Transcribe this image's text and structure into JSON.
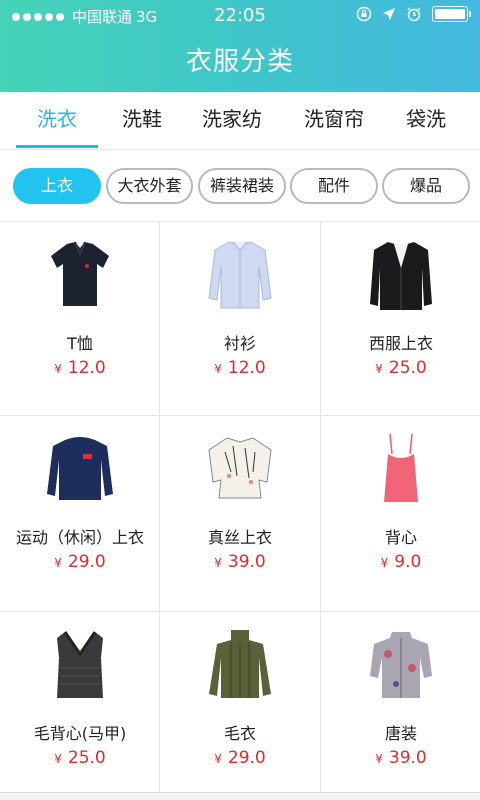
{
  "status_bar": {
    "carrier": "中国联通",
    "network": "3G",
    "time": "22:05"
  },
  "header": {
    "title": "衣服分类"
  },
  "tabs": [
    {
      "label": "洗衣",
      "active": true
    },
    {
      "label": "洗鞋",
      "active": false
    },
    {
      "label": "洗家纺",
      "active": false
    },
    {
      "label": "洗窗帘",
      "active": false
    },
    {
      "label": "袋洗",
      "active": false
    }
  ],
  "subcategories": [
    {
      "label": "上衣",
      "active": true
    },
    {
      "label": "大衣外套",
      "active": false
    },
    {
      "label": "裤装裙装",
      "active": false
    },
    {
      "label": "配件",
      "active": false
    },
    {
      "label": "爆品",
      "active": false
    }
  ],
  "currency": "¥",
  "products": [
    {
      "name": "T恤",
      "price": "12.0",
      "icon": "polo-shirt-image"
    },
    {
      "name": "衬衫",
      "price": "12.0",
      "icon": "dress-shirt-image"
    },
    {
      "name": "西服上衣",
      "price": "25.0",
      "icon": "suit-jacket-image"
    },
    {
      "name": "运动（休闲）上衣",
      "price": "29.0",
      "icon": "sweatshirt-image"
    },
    {
      "name": "真丝上衣",
      "price": "39.0",
      "icon": "silk-blouse-image"
    },
    {
      "name": "背心",
      "price": "9.0",
      "icon": "camisole-image"
    },
    {
      "name": "毛背心(马甲)",
      "price": "25.0",
      "icon": "knit-vest-image"
    },
    {
      "name": "毛衣",
      "price": "29.0",
      "icon": "sweater-image"
    },
    {
      "name": "唐装",
      "price": "39.0",
      "icon": "tang-suit-image"
    }
  ],
  "colors": {
    "accent": "#23c3ef",
    "price": "#e02a2a"
  }
}
